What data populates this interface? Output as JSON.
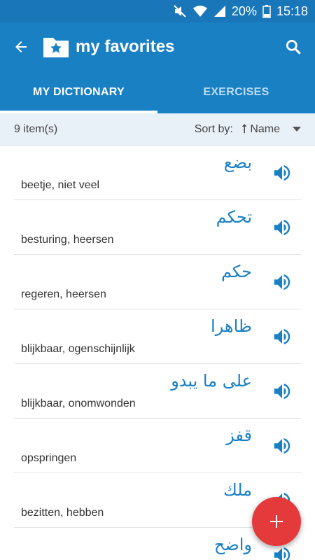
{
  "status_bar": {
    "battery": "20%",
    "time": "15:18"
  },
  "app_bar": {
    "title": "my favorites"
  },
  "tabs": [
    {
      "label": "MY DICTIONARY",
      "active": true
    },
    {
      "label": "EXERCISES",
      "active": false
    }
  ],
  "toolbar": {
    "count": "9 item(s)",
    "sort_label": "Sort by:",
    "sort_value": "Name"
  },
  "words": [
    {
      "arabic": "بضع",
      "meaning": "beetje, niet veel"
    },
    {
      "arabic": "تحكم",
      "meaning": "besturing, heersen"
    },
    {
      "arabic": "حكم",
      "meaning": "regeren, heersen"
    },
    {
      "arabic": "ظاهرا",
      "meaning": "blijkbaar, ogenschijnlijk"
    },
    {
      "arabic": "على ما يبدو",
      "meaning": "blijkbaar, onomwonden"
    },
    {
      "arabic": "قفز",
      "meaning": "opspringen"
    },
    {
      "arabic": "ملك",
      "meaning": "bezitten, hebben"
    },
    {
      "arabic": "واضح",
      "meaning": ""
    }
  ],
  "colors": {
    "primary": "#1a80c4",
    "status": "#1976b8",
    "accent": "#e53a3c"
  }
}
